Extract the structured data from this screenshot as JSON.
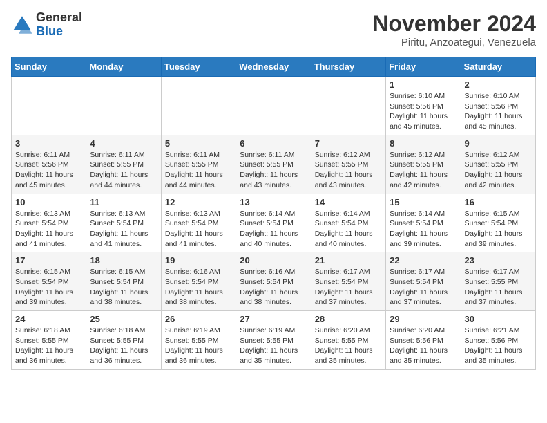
{
  "header": {
    "logo_general": "General",
    "logo_blue": "Blue",
    "month_title": "November 2024",
    "location": "Piritu, Anzoategui, Venezuela"
  },
  "weekdays": [
    "Sunday",
    "Monday",
    "Tuesday",
    "Wednesday",
    "Thursday",
    "Friday",
    "Saturday"
  ],
  "weeks": [
    [
      {
        "day": "",
        "info": ""
      },
      {
        "day": "",
        "info": ""
      },
      {
        "day": "",
        "info": ""
      },
      {
        "day": "",
        "info": ""
      },
      {
        "day": "",
        "info": ""
      },
      {
        "day": "1",
        "info": "Sunrise: 6:10 AM\nSunset: 5:56 PM\nDaylight: 11 hours and 45 minutes."
      },
      {
        "day": "2",
        "info": "Sunrise: 6:10 AM\nSunset: 5:56 PM\nDaylight: 11 hours and 45 minutes."
      }
    ],
    [
      {
        "day": "3",
        "info": "Sunrise: 6:11 AM\nSunset: 5:56 PM\nDaylight: 11 hours and 45 minutes."
      },
      {
        "day": "4",
        "info": "Sunrise: 6:11 AM\nSunset: 5:55 PM\nDaylight: 11 hours and 44 minutes."
      },
      {
        "day": "5",
        "info": "Sunrise: 6:11 AM\nSunset: 5:55 PM\nDaylight: 11 hours and 44 minutes."
      },
      {
        "day": "6",
        "info": "Sunrise: 6:11 AM\nSunset: 5:55 PM\nDaylight: 11 hours and 43 minutes."
      },
      {
        "day": "7",
        "info": "Sunrise: 6:12 AM\nSunset: 5:55 PM\nDaylight: 11 hours and 43 minutes."
      },
      {
        "day": "8",
        "info": "Sunrise: 6:12 AM\nSunset: 5:55 PM\nDaylight: 11 hours and 42 minutes."
      },
      {
        "day": "9",
        "info": "Sunrise: 6:12 AM\nSunset: 5:55 PM\nDaylight: 11 hours and 42 minutes."
      }
    ],
    [
      {
        "day": "10",
        "info": "Sunrise: 6:13 AM\nSunset: 5:54 PM\nDaylight: 11 hours and 41 minutes."
      },
      {
        "day": "11",
        "info": "Sunrise: 6:13 AM\nSunset: 5:54 PM\nDaylight: 11 hours and 41 minutes."
      },
      {
        "day": "12",
        "info": "Sunrise: 6:13 AM\nSunset: 5:54 PM\nDaylight: 11 hours and 41 minutes."
      },
      {
        "day": "13",
        "info": "Sunrise: 6:14 AM\nSunset: 5:54 PM\nDaylight: 11 hours and 40 minutes."
      },
      {
        "day": "14",
        "info": "Sunrise: 6:14 AM\nSunset: 5:54 PM\nDaylight: 11 hours and 40 minutes."
      },
      {
        "day": "15",
        "info": "Sunrise: 6:14 AM\nSunset: 5:54 PM\nDaylight: 11 hours and 39 minutes."
      },
      {
        "day": "16",
        "info": "Sunrise: 6:15 AM\nSunset: 5:54 PM\nDaylight: 11 hours and 39 minutes."
      }
    ],
    [
      {
        "day": "17",
        "info": "Sunrise: 6:15 AM\nSunset: 5:54 PM\nDaylight: 11 hours and 39 minutes."
      },
      {
        "day": "18",
        "info": "Sunrise: 6:15 AM\nSunset: 5:54 PM\nDaylight: 11 hours and 38 minutes."
      },
      {
        "day": "19",
        "info": "Sunrise: 6:16 AM\nSunset: 5:54 PM\nDaylight: 11 hours and 38 minutes."
      },
      {
        "day": "20",
        "info": "Sunrise: 6:16 AM\nSunset: 5:54 PM\nDaylight: 11 hours and 38 minutes."
      },
      {
        "day": "21",
        "info": "Sunrise: 6:17 AM\nSunset: 5:54 PM\nDaylight: 11 hours and 37 minutes."
      },
      {
        "day": "22",
        "info": "Sunrise: 6:17 AM\nSunset: 5:54 PM\nDaylight: 11 hours and 37 minutes."
      },
      {
        "day": "23",
        "info": "Sunrise: 6:17 AM\nSunset: 5:55 PM\nDaylight: 11 hours and 37 minutes."
      }
    ],
    [
      {
        "day": "24",
        "info": "Sunrise: 6:18 AM\nSunset: 5:55 PM\nDaylight: 11 hours and 36 minutes."
      },
      {
        "day": "25",
        "info": "Sunrise: 6:18 AM\nSunset: 5:55 PM\nDaylight: 11 hours and 36 minutes."
      },
      {
        "day": "26",
        "info": "Sunrise: 6:19 AM\nSunset: 5:55 PM\nDaylight: 11 hours and 36 minutes."
      },
      {
        "day": "27",
        "info": "Sunrise: 6:19 AM\nSunset: 5:55 PM\nDaylight: 11 hours and 35 minutes."
      },
      {
        "day": "28",
        "info": "Sunrise: 6:20 AM\nSunset: 5:55 PM\nDaylight: 11 hours and 35 minutes."
      },
      {
        "day": "29",
        "info": "Sunrise: 6:20 AM\nSunset: 5:56 PM\nDaylight: 11 hours and 35 minutes."
      },
      {
        "day": "30",
        "info": "Sunrise: 6:21 AM\nSunset: 5:56 PM\nDaylight: 11 hours and 35 minutes."
      }
    ]
  ]
}
